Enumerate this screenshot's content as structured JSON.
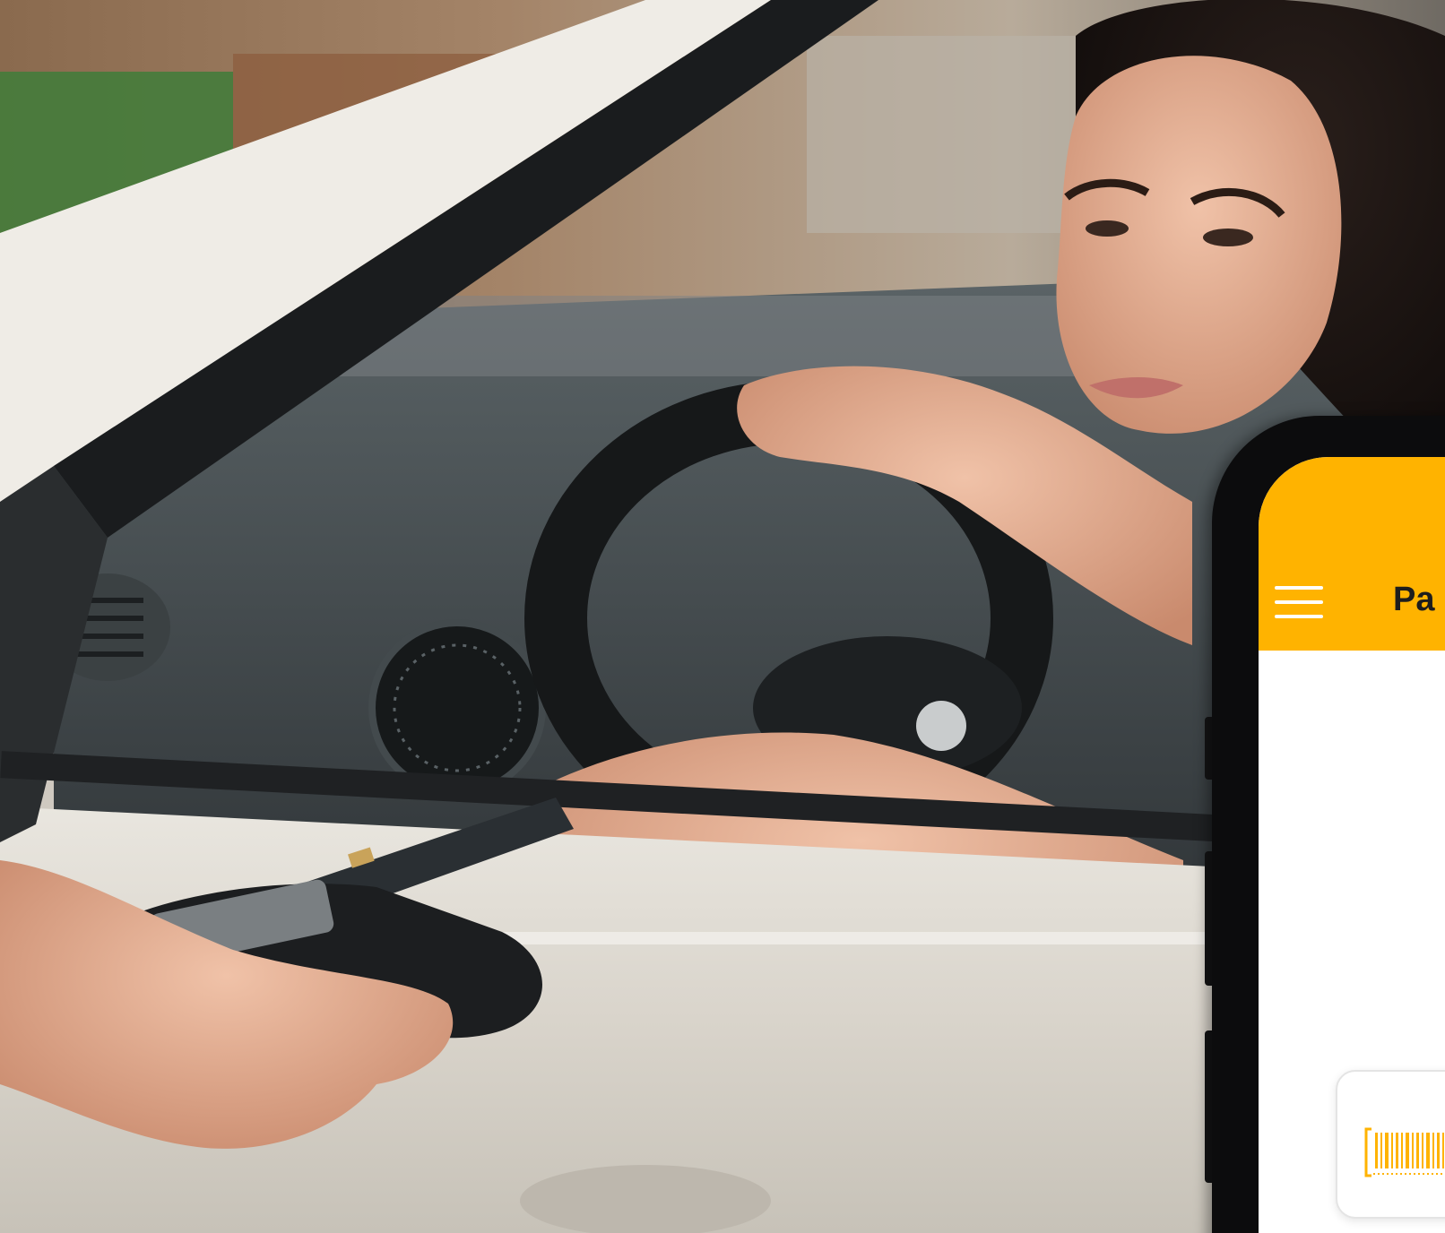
{
  "app": {
    "header_title": "Pa",
    "accent_color": "#ffb300",
    "menu_icon": "hamburger-menu-icon",
    "scan_card_icon": "barcode-scan-icon"
  }
}
